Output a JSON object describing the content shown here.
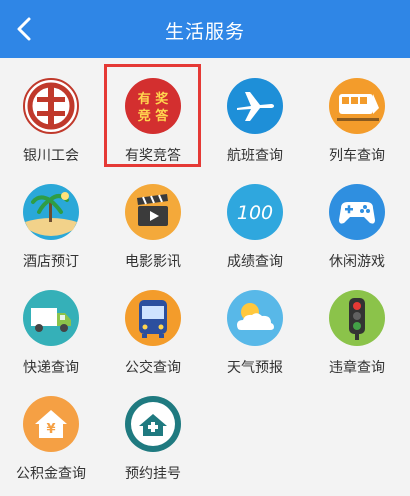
{
  "header": {
    "title": "生活服务",
    "back_icon": "chevron-left-icon",
    "bg_color": "#2f86e6"
  },
  "services": [
    {
      "label": "银川工会",
      "icon": "trade-union-logo-icon",
      "color": "#c0392b"
    },
    {
      "label": "有奖竞答",
      "icon": "prize-quiz-icon",
      "icon_text": "有奖竞答",
      "color": "#d32f2f",
      "highlighted": true
    },
    {
      "label": "航班查询",
      "icon": "airplane-icon",
      "color": "#1e8fd8"
    },
    {
      "label": "列车查询",
      "icon": "train-icon",
      "color": "#f39c2b"
    },
    {
      "label": "酒店预订",
      "icon": "beach-hotel-icon",
      "color": "#2aa8d8"
    },
    {
      "label": "电影影讯",
      "icon": "film-clapper-icon",
      "color": "#f4a93a"
    },
    {
      "label": "成绩查询",
      "icon": "score-100-icon",
      "icon_text": "100",
      "color": "#2fa7de"
    },
    {
      "label": "休闲游戏",
      "icon": "gamepad-icon",
      "color": "#2f8fe0"
    },
    {
      "label": "快递查询",
      "icon": "delivery-truck-icon",
      "color": "#35b0b8"
    },
    {
      "label": "公交查询",
      "icon": "bus-icon",
      "color": "#f39c2b"
    },
    {
      "label": "天气预报",
      "icon": "weather-sun-cloud-icon",
      "color": "#58b8e8"
    },
    {
      "label": "违章查询",
      "icon": "traffic-light-icon",
      "color": "#8bc34a"
    },
    {
      "label": "公积金查询",
      "icon": "housing-fund-icon",
      "icon_text": "¥",
      "color": "#f5a044"
    },
    {
      "label": "预约挂号",
      "icon": "hospital-registration-icon",
      "color": "#1f7a80"
    }
  ]
}
